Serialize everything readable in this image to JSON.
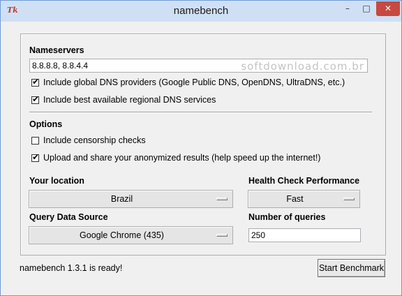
{
  "window": {
    "title": "namebench",
    "icon_text": "Tk",
    "controls": {
      "minimize": "–",
      "maximize": "□",
      "close": "✕"
    }
  },
  "nameservers": {
    "heading": "Nameservers",
    "input_value": "8.8.8.8, 8.8.4.4",
    "watermark": "softdownload.com.br",
    "include_global": {
      "label": "Include global DNS providers (Google Public DNS, OpenDNS, UltraDNS, etc.)",
      "checked": true
    },
    "include_regional": {
      "label": "Include best available regional DNS services",
      "checked": true
    }
  },
  "options": {
    "heading": "Options",
    "censorship": {
      "label": "Include censorship checks",
      "checked": false
    },
    "upload": {
      "label": "Upload and share your anonymized results (help speed up the internet!)",
      "checked": true
    }
  },
  "location": {
    "heading": "Your location",
    "value": "Brazil"
  },
  "health": {
    "heading": "Health Check Performance",
    "value": "Fast"
  },
  "query_source": {
    "heading": "Query Data Source",
    "value": "Google Chrome (435)"
  },
  "num_queries": {
    "heading": "Number of queries",
    "value": "250"
  },
  "status": {
    "text": "namebench 1.3.1 is ready!"
  },
  "start_button": {
    "label": "Start Benchmark"
  }
}
